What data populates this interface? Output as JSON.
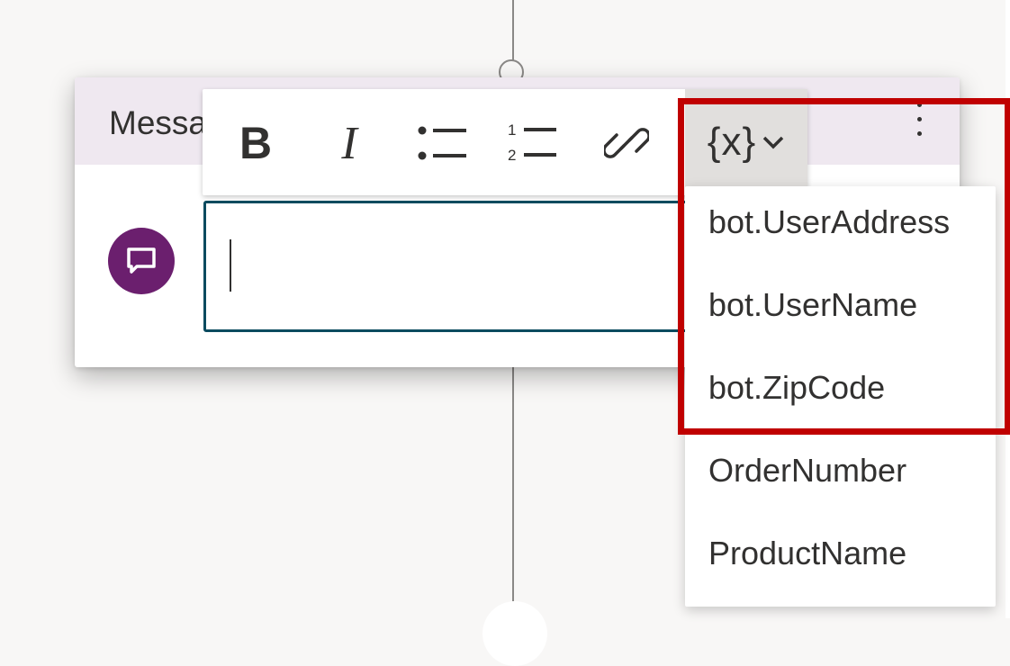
{
  "node": {
    "title": "Message"
  },
  "toolbar": {
    "variable_label": "{x}"
  },
  "variables": {
    "items": [
      "bot.UserAddress",
      "bot.UserName",
      "bot.ZipCode",
      "OrderNumber",
      "ProductName"
    ]
  },
  "colors": {
    "highlight": "#c00000",
    "avatar": "#6b1f6e",
    "header": "#efe8f0",
    "input_border": "#0b4b5f"
  },
  "icons": {
    "avatar": "chat-bubble-icon",
    "bold": "bold-icon",
    "italic": "italic-icon",
    "bullets": "bulleted-list-icon",
    "numbers": "numbered-list-icon",
    "link": "link-icon",
    "variable": "variable-icon",
    "chevron": "chevron-down-icon",
    "more": "more-vertical-icon"
  }
}
